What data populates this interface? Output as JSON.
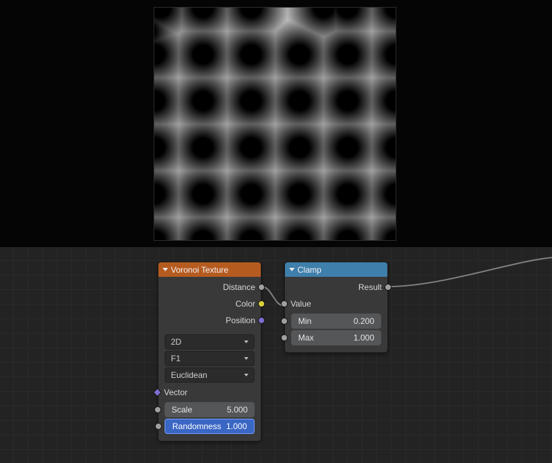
{
  "nodes": {
    "voronoi": {
      "title": "Voronoi Texture",
      "outputs": {
        "distance": "Distance",
        "color": "Color",
        "position": "Position"
      },
      "dropdowns": {
        "dims": "2D",
        "feature": "F1",
        "metric": "Euclidean"
      },
      "inputs": {
        "vector": "Vector"
      },
      "scale": {
        "label": "Scale",
        "value": "5.000"
      },
      "randomness": {
        "label": "Randomness",
        "value": "1.000"
      }
    },
    "clamp": {
      "title": "Clamp",
      "outputs": {
        "result": "Result"
      },
      "inputs": {
        "value": "Value"
      },
      "min": {
        "label": "Min",
        "value": "0.200"
      },
      "max": {
        "label": "Max",
        "value": "1.000"
      }
    }
  }
}
